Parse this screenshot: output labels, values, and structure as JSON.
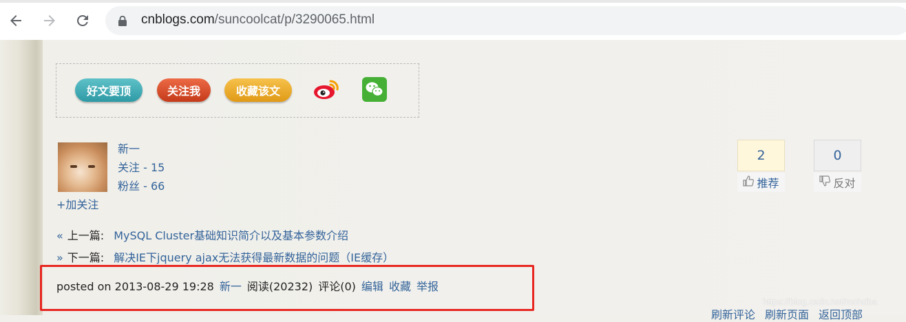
{
  "browser": {
    "url_host": "cnblogs.com",
    "url_path": "/suncoolcat/p/3290065.html",
    "icons": [
      "back-arrow-icon",
      "forward-arrow-icon",
      "reload-icon",
      "lock-icon"
    ]
  },
  "share": {
    "digg_label": "好文要顶",
    "follow_label": "关注我",
    "favorite_label": "收藏该文",
    "icons": [
      "weibo-icon",
      "wechat-icon"
    ]
  },
  "author": {
    "name": "新一",
    "following": "关注 - 15",
    "followers": "粉丝 - 66",
    "add_follow": "+加关注"
  },
  "votes": {
    "up_count": "2",
    "up_label": "推荐",
    "down_count": "0",
    "down_label": "反对"
  },
  "nav": {
    "prev_arrow": "«",
    "prev_label": "上一篇:",
    "prev_title": "MySQL Cluster基础知识简介以及基本参数介绍",
    "next_arrow": "»",
    "next_label": "下一篇:",
    "next_title": "解决IE下jquery ajax无法获得最新数据的问题（IE缓存）"
  },
  "postinfo": {
    "posted": "posted on 2013-08-29 19:28",
    "author": "新一",
    "reads": "阅读(20232)",
    "comments": "评论(0)",
    "edit": "编辑",
    "favorite": "收藏",
    "report": "举报"
  },
  "footer": {
    "refresh_comments": "刷新评论",
    "refresh_page": "刷新页面",
    "back_to_top": "返回顶部"
  },
  "watermark": "https://blog.csdn.net/mchdba",
  "colors": {
    "link": "#33639a",
    "highlight_border": "#e8251f",
    "page_bg": "#f1f0eb"
  }
}
